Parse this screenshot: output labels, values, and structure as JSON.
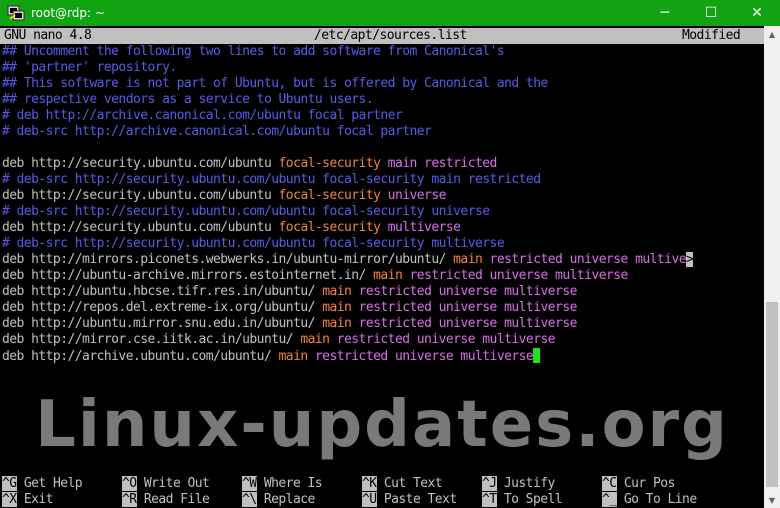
{
  "window": {
    "title": "root@rdp: ~",
    "minimize_glyph": "─",
    "maximize_glyph": "☐",
    "close_glyph": "✕",
    "titlebar_color": "#12a312"
  },
  "nano": {
    "version": "GNU nano 4.8",
    "filename": "/etc/apt/sources.list",
    "status": "Modified"
  },
  "lines": [
    [
      {
        "t": "## Uncomment the following two lines to add software from Canonical's",
        "c": "comment"
      }
    ],
    [
      {
        "t": "## 'partner' repository.",
        "c": "comment"
      }
    ],
    [
      {
        "t": "## This software is not part of Ubuntu, but is offered by Canonical and the",
        "c": "comment"
      }
    ],
    [
      {
        "t": "## respective vendors as a service to Ubuntu users.",
        "c": "comment"
      }
    ],
    [
      {
        "t": "# deb http://archive.canonical.com/ubuntu focal partner",
        "c": "comment"
      }
    ],
    [
      {
        "t": "# deb-src http://archive.canonical.com/ubuntu focal partner",
        "c": "comment"
      }
    ],
    [],
    [
      {
        "t": "deb http://security.ubuntu.com/ubuntu ",
        "c": "default"
      },
      {
        "t": "focal-security",
        "c": "suite"
      },
      {
        "t": " main restricted",
        "c": "comp"
      }
    ],
    [
      {
        "t": "# deb-src http://security.ubuntu.com/ubuntu focal-security main restricted",
        "c": "comment"
      }
    ],
    [
      {
        "t": "deb http://security.ubuntu.com/ubuntu ",
        "c": "default"
      },
      {
        "t": "focal-security",
        "c": "suite"
      },
      {
        "t": " universe",
        "c": "comp"
      }
    ],
    [
      {
        "t": "# deb-src http://security.ubuntu.com/ubuntu focal-security universe",
        "c": "comment"
      }
    ],
    [
      {
        "t": "deb http://security.ubuntu.com/ubuntu ",
        "c": "default"
      },
      {
        "t": "focal-security",
        "c": "suite"
      },
      {
        "t": " multiverse",
        "c": "comp"
      }
    ],
    [
      {
        "t": "# deb-src http://security.ubuntu.com/ubuntu focal-security multiverse",
        "c": "comment"
      }
    ],
    [
      {
        "t": "deb http://mirrors.piconets.webwerks.in/ubuntu-mirror/ubuntu/ ",
        "c": "default"
      },
      {
        "t": "main",
        "c": "suite"
      },
      {
        "t": " restricted universe multive",
        "c": "comp"
      },
      {
        "t": ">",
        "c": "more"
      }
    ],
    [
      {
        "t": "deb http://ubuntu-archive.mirrors.estointernet.in/ ",
        "c": "default"
      },
      {
        "t": "main",
        "c": "suite"
      },
      {
        "t": " restricted universe multiverse",
        "c": "comp"
      }
    ],
    [
      {
        "t": "deb http://ubuntu.hbcse.tifr.res.in/ubuntu/ ",
        "c": "default"
      },
      {
        "t": "main",
        "c": "suite"
      },
      {
        "t": " restricted universe multiverse",
        "c": "comp"
      }
    ],
    [
      {
        "t": "deb http://repos.del.extreme-ix.org/ubuntu/ ",
        "c": "default"
      },
      {
        "t": "main",
        "c": "suite"
      },
      {
        "t": " restricted universe multiverse",
        "c": "comp"
      }
    ],
    [
      {
        "t": "deb http://ubuntu.mirror.snu.edu.in/ubuntu/ ",
        "c": "default"
      },
      {
        "t": "main",
        "c": "suite"
      },
      {
        "t": " restricted universe multiverse",
        "c": "comp"
      }
    ],
    [
      {
        "t": "deb http://mirror.cse.iitk.ac.in/ubuntu/ ",
        "c": "default"
      },
      {
        "t": "main",
        "c": "suite"
      },
      {
        "t": " restricted universe multiverse",
        "c": "comp"
      }
    ],
    [
      {
        "t": "deb http://archive.ubuntu.com/ubuntu/ ",
        "c": "default"
      },
      {
        "t": "main",
        "c": "suite"
      },
      {
        "t": " restricted universe multiverse",
        "c": "comp"
      },
      {
        "t": "",
        "c": "cursor"
      }
    ]
  ],
  "watermark": "Linux-updates.org",
  "shortcuts": [
    [
      {
        "key": "^G",
        "label": "Get Help"
      },
      {
        "key": "^X",
        "label": "Exit"
      }
    ],
    [
      {
        "key": "^O",
        "label": "Write Out"
      },
      {
        "key": "^R",
        "label": "Read File"
      }
    ],
    [
      {
        "key": "^W",
        "label": "Where Is"
      },
      {
        "key": "^\\",
        "label": "Replace"
      }
    ],
    [
      {
        "key": "^K",
        "label": "Cut Text"
      },
      {
        "key": "^U",
        "label": "Paste Text"
      }
    ],
    [
      {
        "key": "^J",
        "label": "Justify"
      },
      {
        "key": "^T",
        "label": "To Spell"
      }
    ],
    [
      {
        "key": "^C",
        "label": "Cur Pos"
      },
      {
        "key": "^_",
        "label": "Go To Line"
      }
    ]
  ],
  "colors": {
    "comment": "#5a5ae6",
    "default": "#c0c0c0",
    "suite": "#f0843c",
    "component": "#d86fe6",
    "cursor": "#19e619"
  },
  "icons": {
    "app": "putty-icon",
    "scroll_up": "scroll-up-arrow-icon",
    "scroll_down": "scroll-down-arrow-icon"
  }
}
